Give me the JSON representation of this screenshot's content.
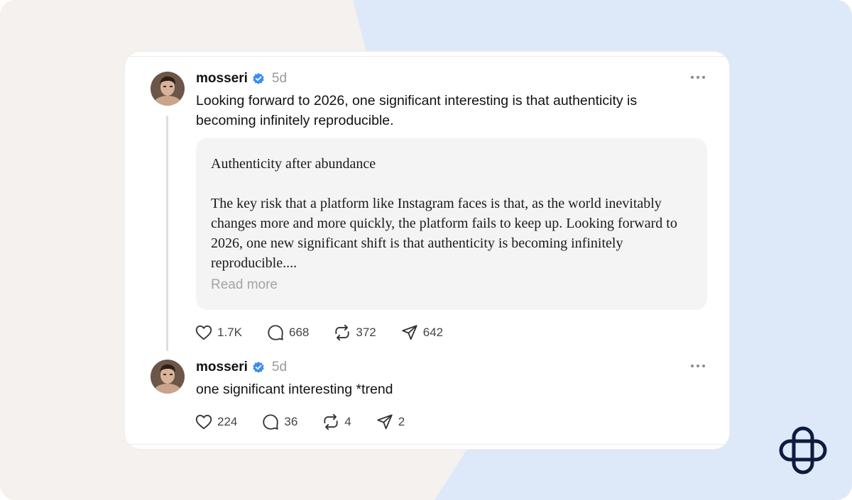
{
  "colors": {
    "background_left": "#f4f1ee",
    "background_right": "#dde9f8",
    "verified": "#3b8cf5",
    "text": "#111111",
    "muted": "#9a9a9a"
  },
  "posts": [
    {
      "username": "mosseri",
      "verified_icon": "verified-badge-icon",
      "time": "5d",
      "text": "Looking forward to 2026, one significant interesting is that authenticity is becoming infinitely reproducible.",
      "quote": {
        "title": "Authenticity after abundance",
        "body": "The key risk that a platform like Instagram faces is that, as the world inevitably changes more and more quickly, the platform fails to keep up. Looking forward to 2026, one new significant shift is that authenticity is becoming infinitely reproducible....",
        "read_more": "Read more"
      },
      "likes": "1.7K",
      "replies": "668",
      "reposts": "372",
      "shares": "642"
    },
    {
      "username": "mosseri",
      "verified_icon": "verified-badge-icon",
      "time": "5d",
      "text": "one significant interesting *trend",
      "likes": "224",
      "replies": "36",
      "reposts": "4",
      "shares": "2"
    }
  ],
  "icons": [
    "more-icon",
    "heart-icon",
    "reply-icon",
    "repost-icon",
    "share-icon",
    "threads-logo-icon"
  ]
}
